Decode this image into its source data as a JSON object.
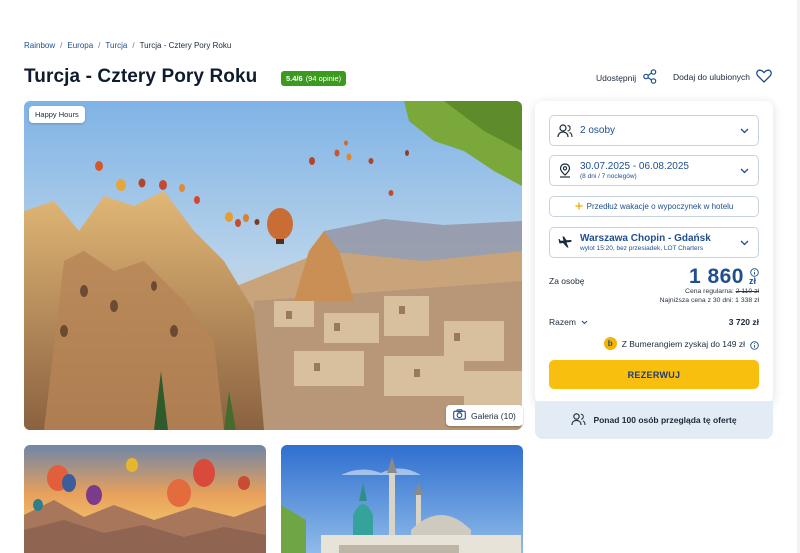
{
  "breadcrumb": [
    "Rainbow",
    "Europa",
    "Turcja",
    "Turcja - Cztery Pory Roku"
  ],
  "title": "Turcja - Cztery Pory Roku",
  "rating": {
    "score": "5.4/6",
    "count": "(94 opinie)",
    "color": "#3c9a1f"
  },
  "actions": {
    "share": "Udostępnij",
    "favorite": "Dodaj do ulubionych"
  },
  "hero": {
    "tag": "Happy Hours",
    "gallery": "Galeria (10)"
  },
  "booking": {
    "persons": "2 osoby",
    "dates": "30.07.2025 - 06.08.2025",
    "dates_sub": "(8 dni / 7 noclegów)",
    "extend": "Przedłuż wakacje o wypoczynek w hotelu",
    "flight": "Warszawa Chopin - Gdańsk",
    "flight_sub": "wylot 15:20, bez przesiadek, LOT Charters",
    "per_person_label": "Za osobę",
    "price": "1 860",
    "currency": "zł",
    "regular_label": "Cena regularna:",
    "regular_price": "2 110 zł",
    "lowest": "Najniższa cena z 30 dni: 1 338 zł",
    "total_label": "Razem",
    "total": "3 720 zł",
    "bumerang": "Z Bumerangiem zyskaj do 149 zł",
    "reserve": "REZERWUJ",
    "viewers": "Ponad 100 osób przegląda tę ofertę"
  },
  "colors": {
    "brand_blue": "#1f4f8f",
    "cta_yellow": "#f9bf0f"
  }
}
